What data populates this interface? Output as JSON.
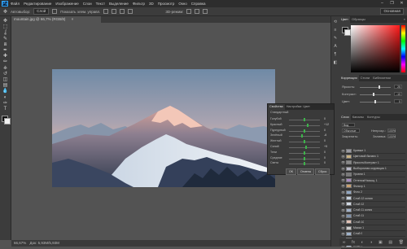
{
  "app": {
    "logo": "Ps"
  },
  "menu": [
    "Файл",
    "Редактирование",
    "Изображение",
    "Слои",
    "Текст",
    "Выделение",
    "Фильтр",
    "3D",
    "Просмотр",
    "Окно",
    "Справка"
  ],
  "window_controls": [
    "–",
    "❐",
    "✕"
  ],
  "options_bar": {
    "items": [
      "Автовыбор:",
      "Слой",
      "Показать элем. управл."
    ],
    "mode_3d": "3D-режим:",
    "workspace": "Основная"
  },
  "document_tab": {
    "title": "mountain.jpg @ 66,7% (RGB/8)",
    "close": "×"
  },
  "toolbar": {
    "tools": [
      "move-icon",
      "marquee-icon",
      "lasso-icon",
      "quick-select-icon",
      "crop-icon",
      "eyedropper-icon",
      "healing-icon",
      "brush-icon",
      "stamp-icon",
      "history-brush-icon",
      "eraser-icon",
      "gradient-icon",
      "blur-icon",
      "dodge-icon",
      "pen-icon",
      "type-icon",
      "path-select-icon",
      "shape-icon",
      "hand-icon",
      "zoom-icon"
    ],
    "glyphs": [
      "✥",
      "⬚",
      "ʆ",
      "✎",
      "⧈",
      "✒",
      "✚",
      "✏",
      "⎈",
      "↺",
      "◫",
      "▤",
      "💧",
      "◐",
      "✑",
      "T",
      "➤",
      "▭",
      "✋",
      "🔍"
    ],
    "fg_color": "#111111",
    "bg_color": "#f0f0f0"
  },
  "status": {
    "zoom": "66,67%",
    "doc": "Док: 5,93M/5,93M"
  },
  "dock_icons": {
    "names": [
      "history-icon",
      "properties-icon",
      "brush-preset-icon",
      "character-icon",
      "paragraph-icon",
      "layers-comp-icon"
    ],
    "glyphs": [
      "⟲",
      "≡",
      "✎",
      "A",
      "¶",
      "◧"
    ]
  },
  "color_panel": {
    "tabs": [
      "Цвет",
      "Образцы"
    ],
    "collapse": "»",
    "hue_color": "#ff1a1a"
  },
  "adjust_panel_right": {
    "tabs": [
      "Коррекция",
      "Стили",
      "Библиотеки"
    ],
    "rows": [
      {
        "label": "Яркость:",
        "value": "25",
        "pos": 0.62
      },
      {
        "label": "Контраст:",
        "value": "-10",
        "pos": 0.45
      },
      {
        "label": "Цвет:",
        "value": "0",
        "pos": 0.5
      }
    ]
  },
  "layers_panel": {
    "tabs": [
      "Слои",
      "Каналы",
      "Контуры"
    ],
    "kind_label": "Вид",
    "blend_mode": "Обычные",
    "opacity_label": "Непрозр.:",
    "opacity_value": "100%",
    "lock_label": "Закрепить:",
    "fill_label": "Заливка:",
    "fill_value": "100%",
    "eye": "👁",
    "layers": [
      {
        "name": "Кривые 1",
        "thumb": "#9a9aa2"
      },
      {
        "name": "Цветовой баланс 1",
        "thumb": "#c8b080"
      },
      {
        "name": "Яркость/Контраст 1",
        "thumb": "#888888"
      },
      {
        "name": "Выборочная коррекция 1",
        "thumb": "#b8b8c8"
      },
      {
        "name": "Уровни 1",
        "thumb": "#7a7a7a"
      },
      {
        "name": "Оттенок/Насыщ. 1",
        "thumb": "#a78ac0"
      },
      {
        "name": "Фильтр 1",
        "thumb": "#c8a070"
      },
      {
        "name": "Фото 2",
        "thumb": "#8fa6c2"
      },
      {
        "name": "Слой 12 копия",
        "thumb": "#c4d0de"
      },
      {
        "name": "Слой 12",
        "thumb": "#d0d8e4"
      },
      {
        "name": "Слой 11 копия",
        "thumb": "#a0b0c8"
      },
      {
        "name": "Слой 11",
        "thumb": "#7f92ad"
      },
      {
        "name": "Слой 10",
        "thumb": "#e2c1b5"
      },
      {
        "name": "Маска 1",
        "thumb": "#cccccc"
      },
      {
        "name": "Слой 9",
        "thumb": "#9eb3cc"
      },
      {
        "name": "Слой 8",
        "thumb": "#4e5f78"
      },
      {
        "name": "Слой 7",
        "thumb": "#b5c4d6"
      }
    ],
    "footer_icons": [
      "∞",
      "fx",
      "◐",
      "◑",
      "▣",
      "▤",
      "🗑"
    ]
  },
  "adjustments_float": {
    "tabs": [
      "Свойства",
      "Настройки: Цвет"
    ],
    "preset_label": "Стандартный",
    "rows": [
      {
        "label": "Голубой",
        "value": "0",
        "pos": 0.5
      },
      {
        "label": "Красный",
        "value": "+12",
        "pos": 0.6
      },
      {
        "label": "Пурпурный",
        "value": "0",
        "pos": 0.5
      },
      {
        "label": "Зелёный",
        "value": "-8",
        "pos": 0.42
      },
      {
        "label": "Желтый",
        "value": "0",
        "pos": 0.5
      },
      {
        "label": "Синий",
        "value": "+5",
        "pos": 0.55
      },
      {
        "label": "Тени",
        "value": "0",
        "pos": 0.5
      },
      {
        "label": "Средние",
        "value": "0",
        "pos": 0.5
      },
      {
        "label": "Света",
        "value": "0",
        "pos": 0.5
      }
    ],
    "buttons": [
      "OK",
      "Отмена",
      "Сброс"
    ]
  }
}
